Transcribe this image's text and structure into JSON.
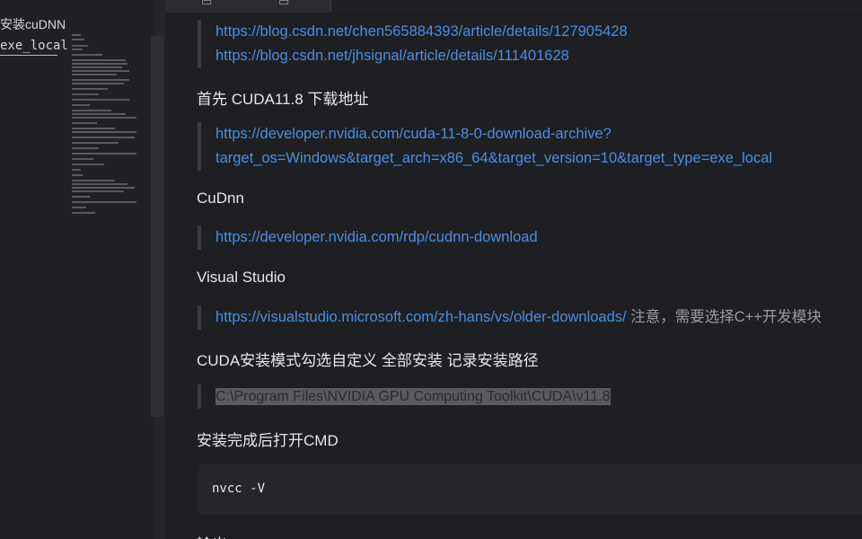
{
  "sidebar": {
    "outline_title": "安装cuDNN",
    "outline_sub": "exe_local"
  },
  "tabs": [
    {
      "icon": "tab-glyph-a"
    },
    {
      "icon": "tab-glyph-b"
    }
  ],
  "document": {
    "links_group1": [
      "https://blog.csdn.net/chen565884393/article/details/127905428",
      "https://blog.csdn.net/jhsignal/article/details/111401628"
    ],
    "heading_cuda": "首先 CUDA11.8 下载地址",
    "cuda_link_line1": "https://developer.nvidia.com/cuda-11-8-0-download-archive?",
    "cuda_link_line2": "target_os=Windows&target_arch=x86_64&target_version=10&target_type=exe_local",
    "heading_cudnn": "CuDnn",
    "cudnn_link": "https://developer.nvidia.com/rdp/cudnn-download",
    "heading_vs": "Visual Studio",
    "vs_link": "https://visualstudio.microsoft.com/zh-hans/vs/older-downloads/",
    "vs_note": " 注意，需要选择C++开发模块",
    "heading_install": "CUDA安装模式勾选自定义 全部安装 记录安装路径",
    "install_path": "C:\\Program Files\\NVIDIA GPU Computing Toolkit\\CUDA\\v11.8",
    "heading_cmd": "安装完成后打开CMD",
    "code": "nvcc -V",
    "heading_output": "输出"
  },
  "colors": {
    "link": "#4a8fe0",
    "background": "#1e1f22",
    "text": "#e6e6e6"
  }
}
